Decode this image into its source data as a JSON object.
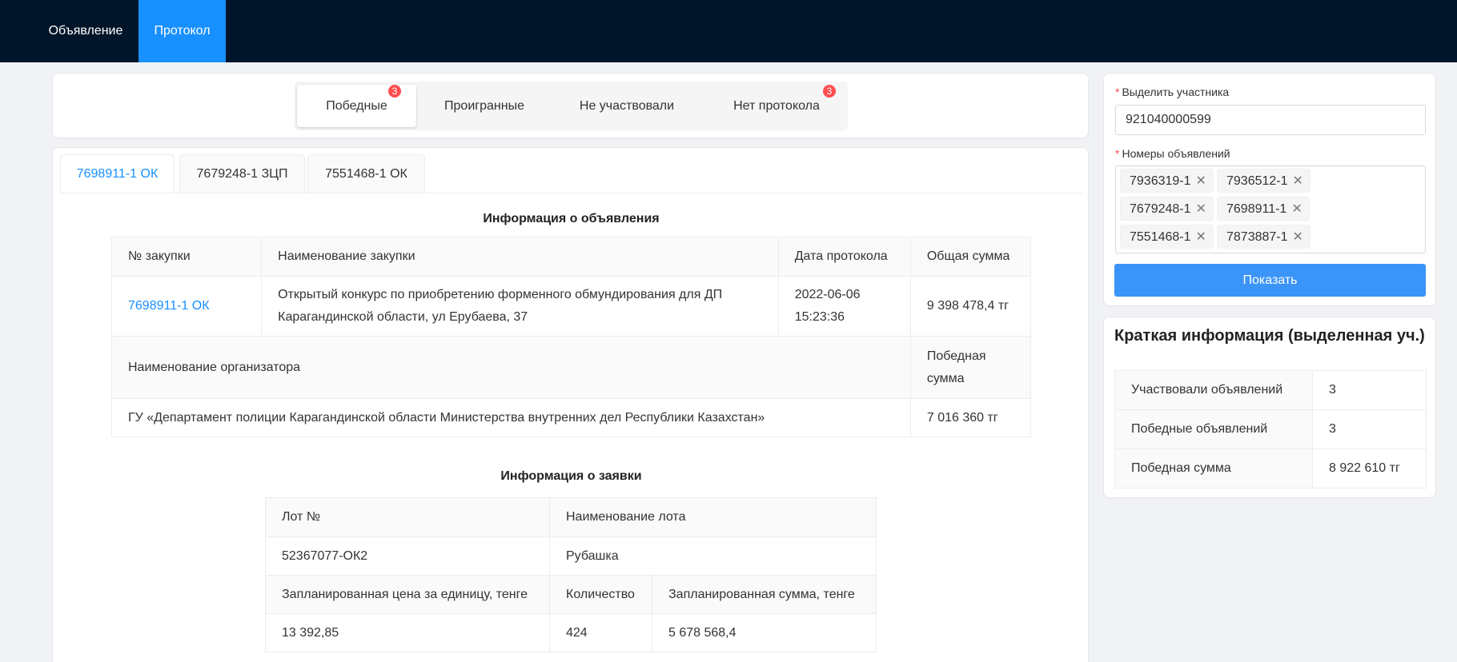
{
  "nav": {
    "items": [
      "Объявление",
      "Протокол"
    ],
    "active": "Протокол"
  },
  "filter": {
    "segments": [
      "Победные",
      "Проигранные",
      "Не участвовали",
      "Нет протокола"
    ],
    "badges": {
      "wins": "3",
      "no_protocol": "3"
    }
  },
  "tabs": [
    "7698911-1 ОК",
    "7679248-1 ЗЦП",
    "7551468-1 ОК"
  ],
  "announcement_info": {
    "title": "Информация о объявления",
    "headers": [
      "№ закупки",
      "Наименование закупки",
      "Дата протокола",
      "Общая сумма"
    ],
    "purchase_no": "7698911-1 ОК",
    "purchase_name": "Открытый конкурс по приобретению форменного обмундирования для ДП Карагандинской области, ул Ерубаева, 37",
    "protocol_date": "2022-06-06 15:23:36",
    "total_sum": "9 398 478,4 тг",
    "organizer_header": "Наименование организатора",
    "win_sum_header": "Победная сумма",
    "organizer": "ГУ «Департамент полиции Карагандинской области Министерства внутренних дел Республики Казахстан»",
    "win_sum": "7 016 360 тг"
  },
  "bid_info": {
    "title": "Информация о заявки",
    "lot_header": "Лот №",
    "lot_name_header": "Наименование лота",
    "lot_no": "52367077-ОК2",
    "lot_name": "Рубашка",
    "unit_price_header": "Запланированная цена за единицу, тенге",
    "qty_header": "Количество",
    "planned_sum_header": "Запланированная сумма, тенге",
    "unit_price": "13 392,85",
    "qty": "424",
    "planned_sum": "5 678 568,4"
  },
  "form": {
    "participant_label": "Выделить участника",
    "participant_value": "921040000599",
    "numbers_label": "Номеры объявлений",
    "chips": [
      "7936319-1",
      "7936512-1",
      "7679248-1",
      "7698911-1",
      "7551468-1",
      "7873887-1"
    ],
    "chip_remove": "✕",
    "submit_label": "Показать",
    "colors": {
      "primary": "#1890ff",
      "required": "#ff4d4f"
    }
  },
  "summary": {
    "title": "Краткая информация (выделенная уч.)",
    "rows": [
      {
        "label": "Участвовали объявлений",
        "value": "3"
      },
      {
        "label": "Победные объявлений",
        "value": "3"
      },
      {
        "label": "Победная сумма",
        "value": "8 922 610 тг"
      }
    ]
  }
}
